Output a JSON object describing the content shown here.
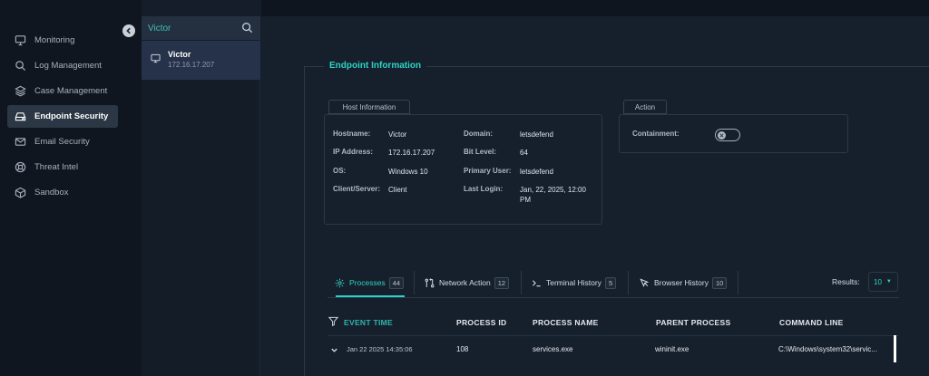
{
  "nav": {
    "items": [
      {
        "label": "Monitoring",
        "icon": "monitor-icon"
      },
      {
        "label": "Log Management",
        "icon": "search-icon"
      },
      {
        "label": "Case Management",
        "icon": "layers-icon"
      },
      {
        "label": "Endpoint Security",
        "icon": "hard-drive-icon",
        "active": true
      },
      {
        "label": "Email Security",
        "icon": "mail-icon"
      },
      {
        "label": "Threat Intel",
        "icon": "lifebuoy-icon"
      },
      {
        "label": "Sandbox",
        "icon": "box-icon"
      }
    ]
  },
  "search": {
    "value": "Victor",
    "results": [
      {
        "name": "Victor",
        "ip": "172.16.17.207"
      }
    ]
  },
  "endpoint": {
    "title": "Endpoint Information",
    "host_info_tab": "Host Information",
    "action_tab": "Action",
    "fields": {
      "hostname_label": "Hostname:",
      "hostname": "Victor",
      "ip_label": "IP Address:",
      "ip": "172.16.17.207",
      "os_label": "OS:",
      "os": "Windows 10",
      "client_label": "Client/Server:",
      "client": "Client",
      "domain_label": "Domain:",
      "domain": "letsdefend",
      "bit_label": "Bit Level:",
      "bit": "64",
      "user_label": "Primary User:",
      "user": "letsdefend",
      "login_label": "Last Login:",
      "login_line1": "Jan, 22, 2025, 12:00",
      "login_line2": "PM"
    },
    "containment_label": "Containment:",
    "containment_on": false
  },
  "tabs": [
    {
      "label": "Processes",
      "count": "44",
      "icon": "gear-icon",
      "active": true
    },
    {
      "label": "Network Action",
      "count": "12",
      "icon": "git-compare-icon"
    },
    {
      "label": "Terminal History",
      "count": "5",
      "icon": "terminal-icon"
    },
    {
      "label": "Browser History",
      "count": "10",
      "icon": "cursor-icon"
    }
  ],
  "results": {
    "label": "Results:",
    "value": "10"
  },
  "table": {
    "columns": [
      "EVENT TIME",
      "PROCESS ID",
      "PROCESS NAME",
      "PARENT PROCESS",
      "COMMAND LINE"
    ],
    "rows": [
      {
        "time": "Jan 22 2025 14:35:06",
        "pid": "108",
        "name": "services.exe",
        "parent": "wininit.exe",
        "cmd": "C:\\Windows\\system32\\servic..."
      }
    ]
  },
  "colors": {
    "accent": "#2fd1c4",
    "active_nav": "#2b3744",
    "background": "#151d2b"
  }
}
